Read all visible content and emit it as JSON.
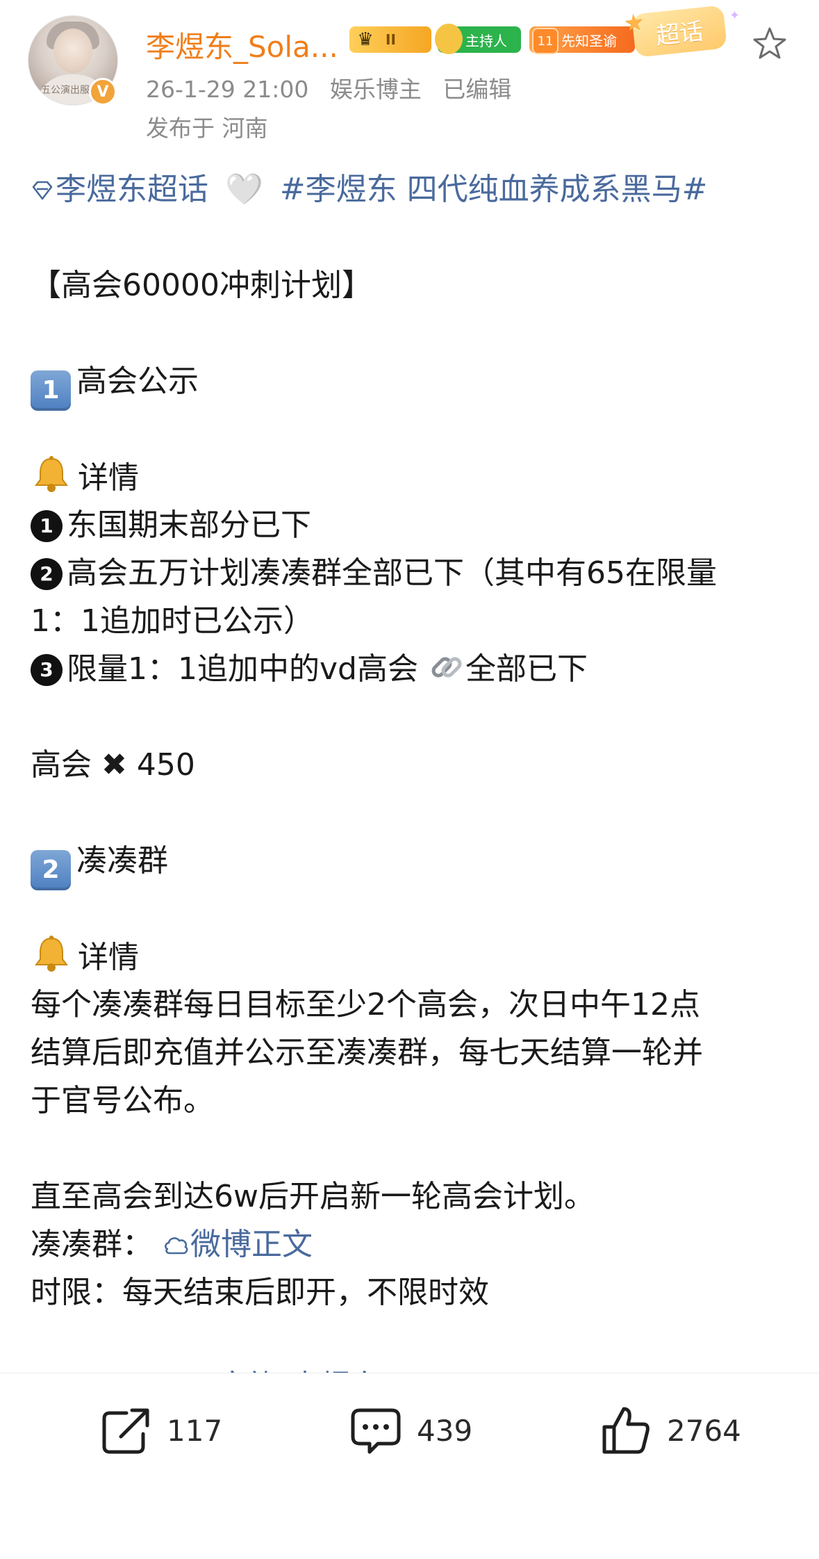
{
  "post": {
    "author": {
      "name": "李煜东_Sola...",
      "avatar_text": "五公演出服",
      "verified_mark": "V",
      "badges": {
        "level": "II",
        "host": "主持人",
        "prophet_num": "11",
        "prophet": "先知圣谕",
        "chaohua": "超话"
      }
    },
    "meta": {
      "time": "26-1-29 21:00",
      "category": "娱乐博主",
      "edited": "已编辑",
      "location": "发布于 河南"
    },
    "topic_link": "李煜东超话",
    "heart": "🤍",
    "hashtag": "#李煜东 四代纯血养成系黑马#",
    "lines": {
      "title": "【高会60000冲刺计划】",
      "s1_num": "1",
      "s1_title": "高会公示",
      "detail": "详情",
      "item1_num": "1",
      "item1": "东国期末部分已下",
      "item2_num": "2",
      "item2": "高会五万计划凑凑群全部已下（其中有65在限量",
      "item2_cont": "1：1追加时已公示）",
      "item3_num": "3",
      "item3_a": "限量1：1追加中的vd高会",
      "item3_b": "全部已下",
      "count_label": "高会",
      "cross": "✖",
      "count_value": "450",
      "s2_num": "2",
      "s2_title": "凑凑群",
      "detail2": "详情",
      "para1": "每个凑凑群每日目标至少2个高会，次日中午12点",
      "para2": "结算后即充值并公示至凑凑群，每七天结算一轮并",
      "para3": "于官号公布。",
      "para4": "直至高会到达6w后开启新一轮高会计划。",
      "group_label": "凑凑群：",
      "group_link": "微博正文",
      "time_limit": "时限：每天结束后即开，不限时效",
      "cut_text": "All FOR",
      "cut_link": "@TF家族-李煜东LYD_R"
    }
  },
  "toolbar": {
    "repost_count": "117",
    "comment_count": "439",
    "like_count": "2764"
  }
}
